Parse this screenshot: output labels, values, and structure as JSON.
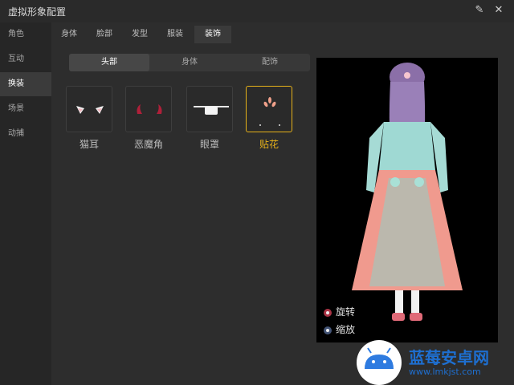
{
  "window": {
    "title": "虚拟形象配置"
  },
  "sidebar": {
    "items": [
      {
        "label": "角色"
      },
      {
        "label": "互动"
      },
      {
        "label": "换装"
      },
      {
        "label": "场景"
      },
      {
        "label": "动捕"
      }
    ]
  },
  "tabs": [
    {
      "label": "身体"
    },
    {
      "label": "脸部"
    },
    {
      "label": "发型"
    },
    {
      "label": "服装"
    },
    {
      "label": "装饰"
    }
  ],
  "subtabs": [
    {
      "label": "头部"
    },
    {
      "label": "身体"
    },
    {
      "label": "配饰"
    }
  ],
  "items": [
    {
      "label": "猫耳"
    },
    {
      "label": "恶魔角"
    },
    {
      "label": "眼罩"
    },
    {
      "label": "贴花"
    }
  ],
  "preview": {
    "controls": {
      "rotate": "旋转",
      "zoom": "缩放"
    }
  },
  "watermark": {
    "brand": "蓝莓安卓网",
    "url": "www.lmkjst.com"
  },
  "colors": {
    "accent": "#e7b21a",
    "brand_blue": "#1e6fd0"
  }
}
